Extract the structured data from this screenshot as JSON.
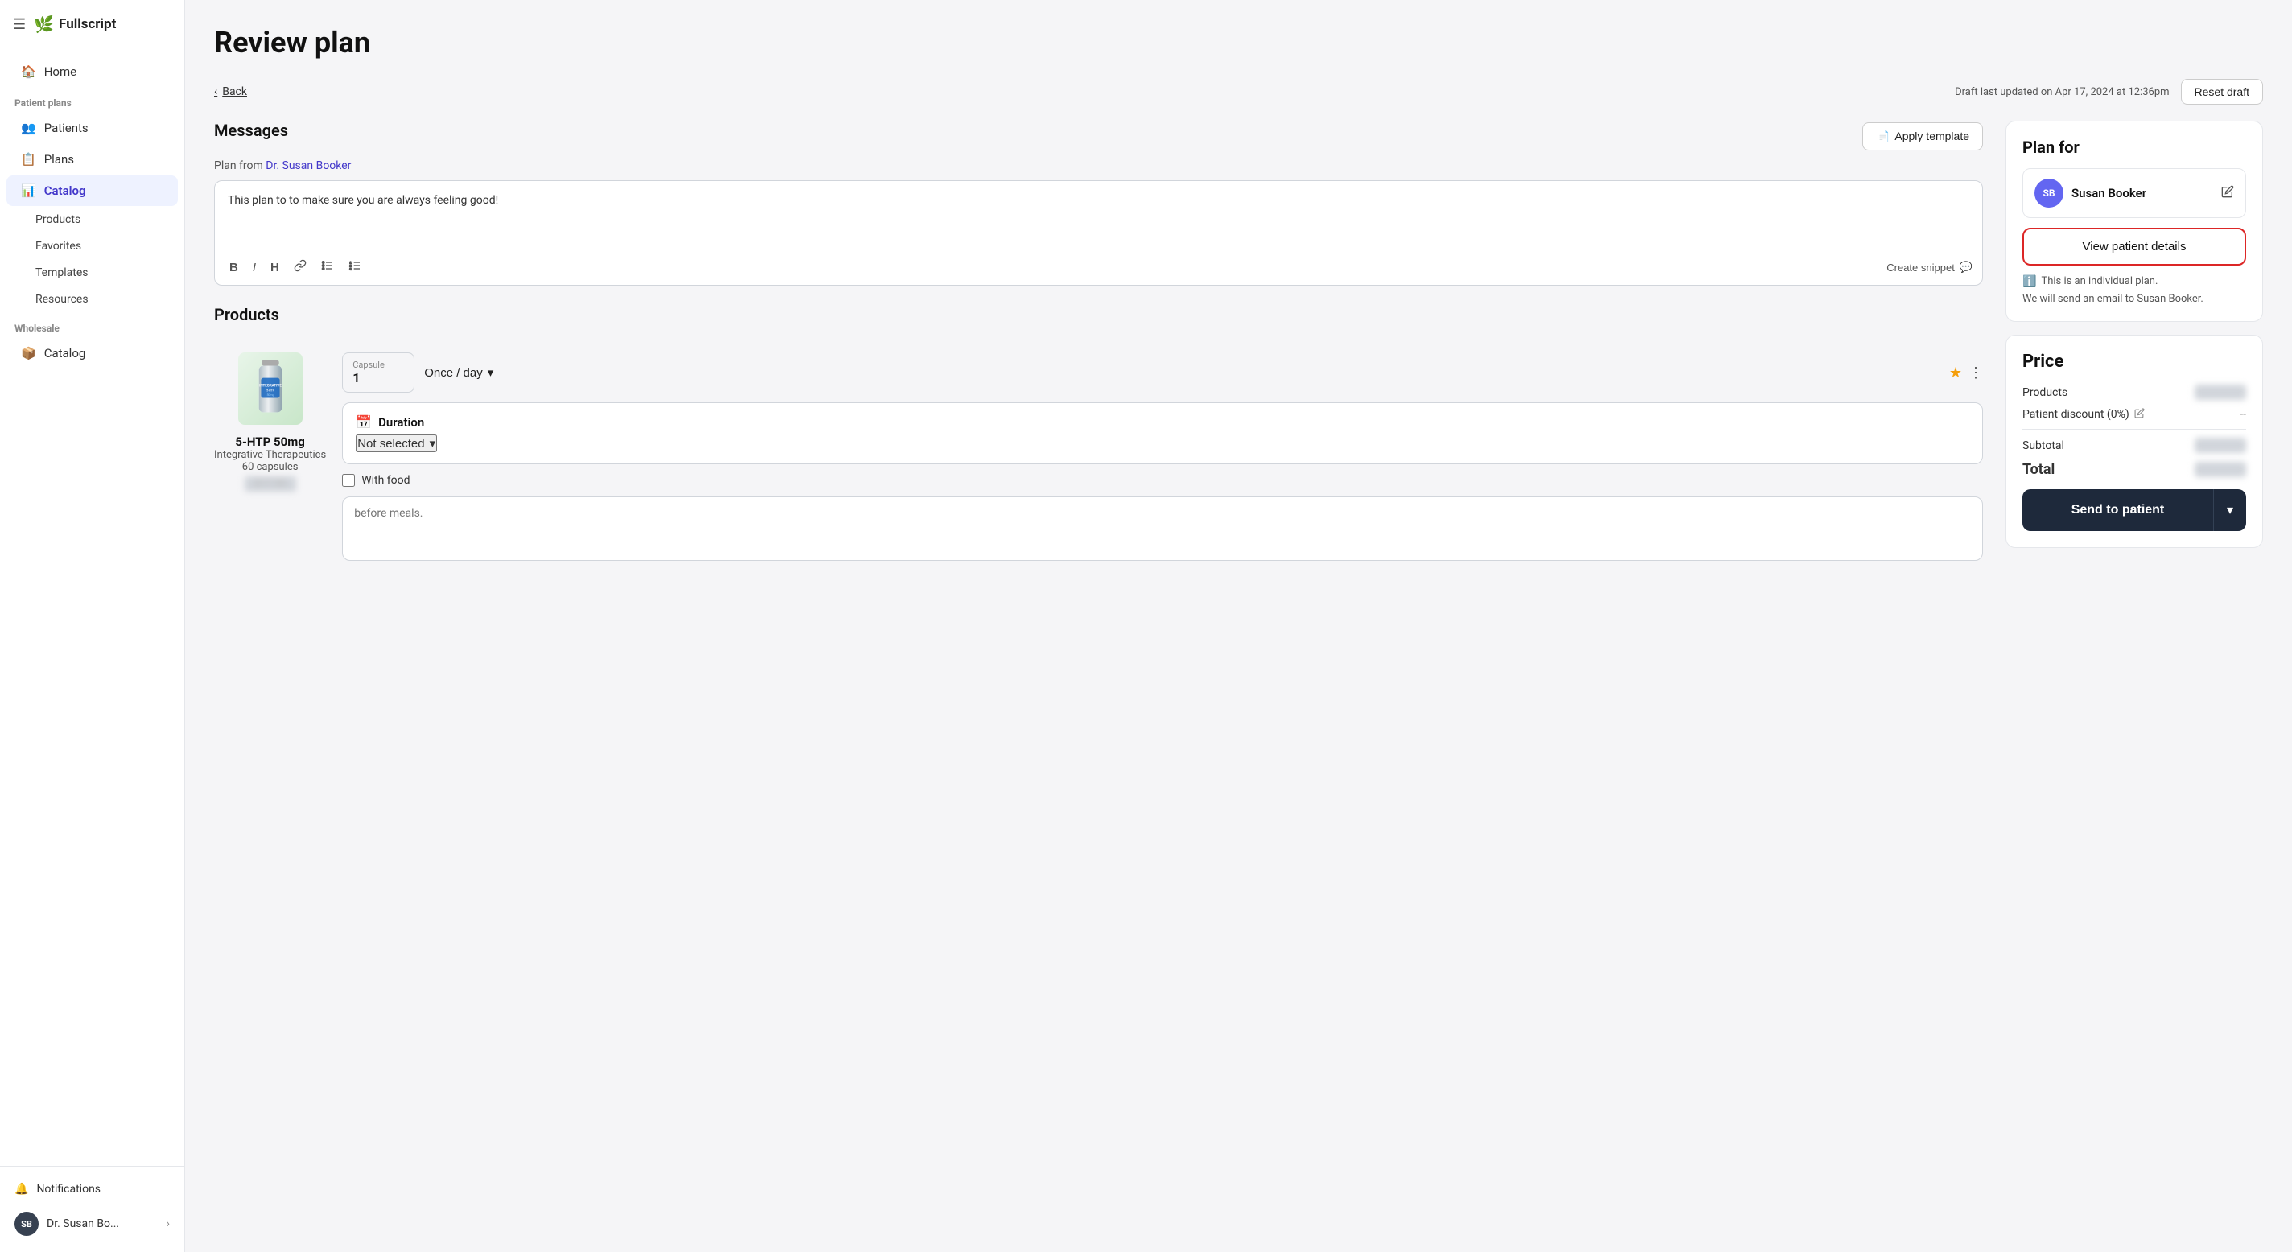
{
  "sidebar": {
    "logo": "Fullscript",
    "nav_items": [
      {
        "id": "home",
        "label": "Home",
        "icon": "home"
      },
      {
        "id": "patients",
        "label": "Patients",
        "icon": "patients",
        "section": "Patient plans"
      },
      {
        "id": "plans",
        "label": "Plans",
        "icon": "plans"
      },
      {
        "id": "catalog",
        "label": "Catalog",
        "icon": "catalog",
        "active": true
      }
    ],
    "catalog_sub": [
      {
        "id": "products",
        "label": "Products"
      },
      {
        "id": "favorites",
        "label": "Favorites"
      },
      {
        "id": "templates",
        "label": "Templates"
      },
      {
        "id": "resources",
        "label": "Resources"
      }
    ],
    "wholesale_label": "Wholesale",
    "wholesale_items": [
      {
        "id": "wholesale-catalog",
        "label": "Catalog",
        "icon": "catalog"
      }
    ],
    "notifications": "Notifications",
    "user_name": "Dr. Susan Bo...",
    "user_initials": "SB"
  },
  "page": {
    "title": "Review plan",
    "back_label": "Back",
    "draft_info": "Draft last updated on Apr 17, 2024 at 12:36pm",
    "reset_draft": "Reset draft"
  },
  "messages": {
    "section_label": "Messages",
    "plan_from_prefix": "Plan from ",
    "plan_from_name": "Dr. Susan Booker",
    "apply_template": "Apply template",
    "message_text": "This plan to to make sure you are always feeling good!",
    "create_snippet": "Create snippet",
    "toolbar": {
      "bold": "B",
      "italic": "I",
      "heading": "H",
      "link": "🔗",
      "bullet": "≡",
      "numbered": "≣"
    }
  },
  "products_section": {
    "label": "Products",
    "product": {
      "name": "5-HTP 50mg",
      "brand": "Integrative Therapeutics",
      "size": "60 capsules",
      "price_blurred": "$17.99",
      "capsule_label": "Capsule",
      "capsule_value": "1",
      "frequency": "Once / day",
      "duration_label": "Duration",
      "duration_value": "Not selected",
      "with_food_label": "With food",
      "notes_placeholder": "before meals."
    }
  },
  "plan_for": {
    "title": "Plan for",
    "patient_name": "Susan Booker",
    "patient_initials": "SB",
    "view_patient_btn": "View patient details",
    "individual_plan_note": "This is an individual plan.",
    "email_note": "We will send an email to Susan Booker."
  },
  "price": {
    "title": "Price",
    "products_label": "Products",
    "products_value": "$17.99",
    "discount_label": "Patient discount (0%)",
    "discount_value": "--",
    "subtotal_label": "Subtotal",
    "subtotal_value": "$17.99",
    "total_label": "Total",
    "total_value": "$17.99",
    "send_btn": "Send to patient"
  }
}
